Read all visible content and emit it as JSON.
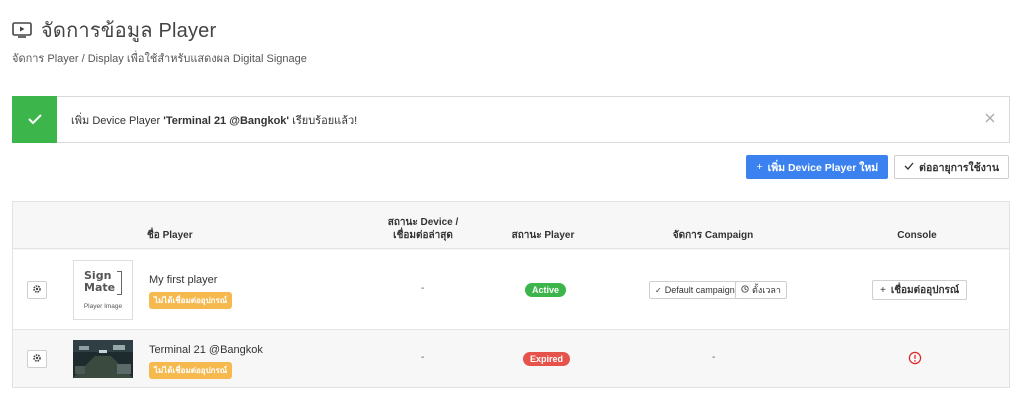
{
  "header": {
    "title": "จัดการข้อมูล Player",
    "subtitle": "จัดการ Player / Display เพื่อใช้สำหรับแสดงผล Digital Signage"
  },
  "alert": {
    "prefix": "เพิ่ม Device Player ",
    "player": "'Terminal 21 @Bangkok'",
    "suffix": " เรียบร้อยแล้ว!"
  },
  "actions": {
    "add_label": "เพิ่ม Device Player ใหม่",
    "renew_label": "ต่ออายุการใช้งาน"
  },
  "table": {
    "headers": {
      "name": "ชื่อ Player",
      "device_status_1": "สถานะ Device /",
      "device_status_2": "เชื่อมต่อล่าสุด",
      "player_status": "สถานะ Player",
      "campaign": "จัดการ Campaign",
      "console": "Console"
    },
    "rows": [
      {
        "name": "My first player",
        "badge": "ไม่ได้เชื่อมต่ออุปกรณ์",
        "device_status": "-",
        "status": "Active",
        "campaign_default": "Default campaign",
        "campaign_schedule": "ตั้งเวลา",
        "console_label": "เชื่อมต่ออุปกรณ์",
        "logo_line1": "Sign",
        "logo_line2": "Mate",
        "logo_caption": "Player Image"
      },
      {
        "name": "Terminal 21 @Bangkok",
        "badge": "ไม่ได้เชื่อมต่ออุปกรณ์",
        "device_status": "-",
        "status": "Expired",
        "campaign": "-"
      }
    ]
  },
  "colors": {
    "primary": "#3b82f0",
    "success": "#3cb54a",
    "danger": "#e5534b",
    "warning": "#f5b94d"
  }
}
